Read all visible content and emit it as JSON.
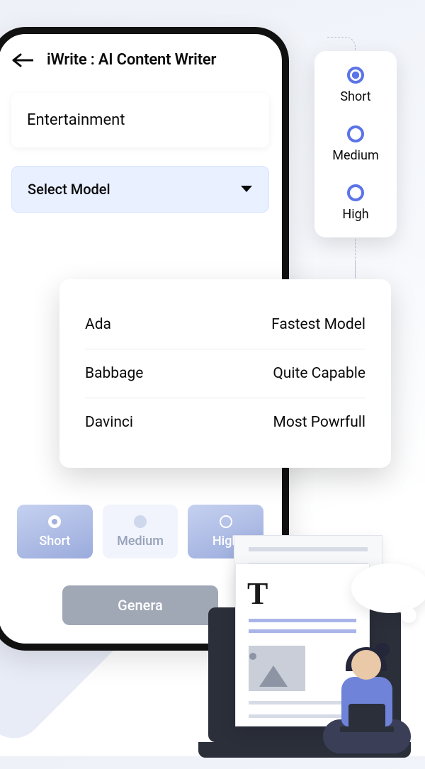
{
  "header": {
    "app_title": "iWrite : AI Content Writer"
  },
  "topic": {
    "value": "Entertainment"
  },
  "select_model": {
    "label": "Select Model"
  },
  "models": [
    {
      "name": "Ada",
      "desc": "Fastest Model"
    },
    {
      "name": "Babbage",
      "desc": "Quite Capable"
    },
    {
      "name": "Davinci",
      "desc": "Most Powrfull"
    }
  ],
  "side_lengths": [
    {
      "label": "Short",
      "selected": true
    },
    {
      "label": "Medium",
      "selected": false
    },
    {
      "label": "High",
      "selected": false
    }
  ],
  "length_chips": [
    {
      "label": "Short",
      "state": "selected"
    },
    {
      "label": "Medium",
      "state": "dim"
    },
    {
      "label": "High",
      "state": "high"
    }
  ],
  "generate": {
    "label": "Genera"
  }
}
